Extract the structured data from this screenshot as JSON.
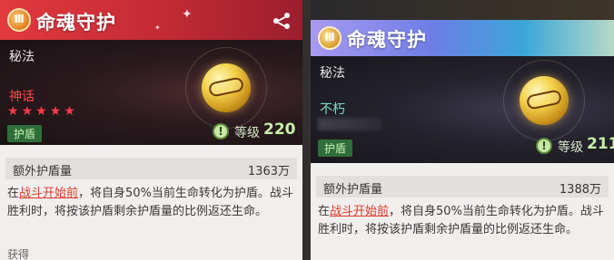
{
  "cards": [
    {
      "title": "命魂守护",
      "icon_glyph": "Ⅲ",
      "subcategory": "秘法",
      "rarity": "神话",
      "stars": 5,
      "tag": "护盾",
      "level_icon": "!",
      "level_label": "等级",
      "level": "220",
      "stat_name": "额外护盾量",
      "stat_value": "1363万",
      "desc_prefix": "在",
      "desc_highlight": "战斗开始前",
      "desc_suffix": "，将自身50%当前生命转化为护盾。战斗胜利时，将按该护盾剩余护盾量的比例返还生命。",
      "more_text": "获得"
    },
    {
      "title": "命魂守护",
      "icon_glyph": "Ⅲ",
      "subcategory": "秘法",
      "rarity": "不朽",
      "tag": "护盾",
      "level_icon": "!",
      "level_label": "等级",
      "level": "211",
      "stat_name": "额外护盾量",
      "stat_value": "1388万",
      "desc_prefix": "在",
      "desc_highlight": "战斗开始前",
      "desc_suffix": "，将自身50%当前生命转化为护盾。战斗胜利时，将按该护盾剩余护盾量的比例返还生命。"
    }
  ],
  "colors": {
    "red_header": "#c22a35",
    "purple_header": "#6e7ee6",
    "rarity_mythic": "#ff4a4e",
    "rarity_immortal": "#7adcc8",
    "level_green": "#c8f0a8",
    "highlight": "#e03a2a"
  },
  "icons": [
    "share-icon",
    "relic-coin-icon",
    "level-info-icon",
    "star-icon"
  ]
}
